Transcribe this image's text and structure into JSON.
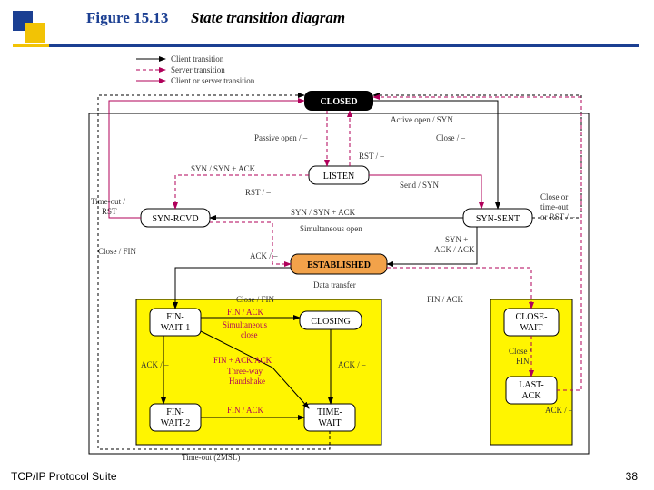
{
  "figure_label": "Figure 15.13",
  "figure_title": "State transition diagram",
  "footer": "TCP/IP Protocol Suite",
  "page_number": "38",
  "legend": {
    "client": "Client transition",
    "server": "Server transition",
    "both": "Client or server transition"
  },
  "states": {
    "closed": "CLOSED",
    "listen": "LISTEN",
    "syn_rcvd": "SYN-RCVD",
    "syn_sent": "SYN-SENT",
    "established": "ESTABLISHED",
    "fin_wait_1": "FIN-\nWAIT-1",
    "closing": "CLOSING",
    "close_wait": "CLOSE-\nWAIT",
    "last_ack": "LAST-\nACK",
    "fin_wait_2": "FIN-\nWAIT-2",
    "time_wait": "TIME-\nWAIT"
  },
  "edges": {
    "passive_open": "Passive open / –",
    "active_open": "Active open / SYN",
    "close1": "Close / –",
    "rst1": "RST / –",
    "syn_synack": "SYN / SYN + ACK",
    "rst2": "RST / –",
    "send_syn": "Send / SYN",
    "timeout_rst": "Time-out /\nRST",
    "syn_synack2": "SYN / SYN + ACK",
    "simul_open": "Simultaneous open",
    "syn_ack_ack": "SYN +\nACK / ACK",
    "close_timeout_rst": "Close or\ntime-out\nor RST / –",
    "close_fin": "Close / FIN",
    "ack1": "ACK / –",
    "data_transfer": "Data transfer",
    "close_fin2": "Close / FIN",
    "fin_ack1": "FIN / ACK",
    "fin_ack2": "FIN / ACK",
    "simul_close": "Simultaneous\nclose",
    "ack2": "ACK / –",
    "fin_ack_ack": "FIN + ACK/ACK",
    "three_way": "Three-way\nHandshake",
    "ack3": "ACK / –",
    "fin_ack3": "FIN / ACK",
    "timeout_2msl": "Time-out (2MSL)",
    "close_fin3": "Close /\nFIN",
    "ack4": "ACK / –"
  }
}
